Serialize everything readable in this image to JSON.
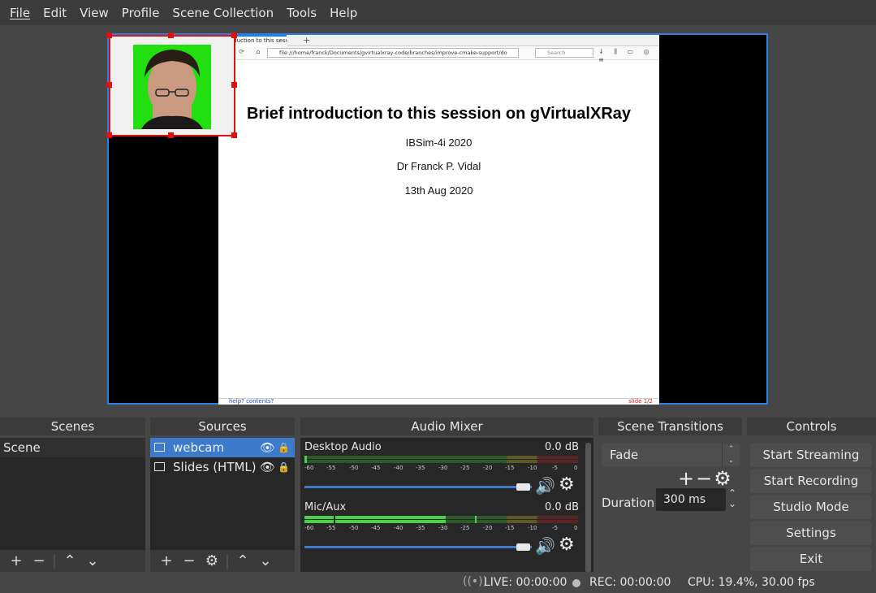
{
  "menu": [
    "File",
    "Edit",
    "View",
    "Profile",
    "Scene Collection",
    "Tools",
    "Help"
  ],
  "preview": {
    "browser": {
      "tab_title": "Introduction to this sess",
      "new_tab": "+",
      "url": "file:///home/franck/Documents/gvirtualxray-code/branches/improve-cmake-support/do",
      "search_placeholder": "Search",
      "slide_title": "Brief introduction to this session on gVirtualXRay",
      "event": "IBSim-4i 2020",
      "author": "Dr Franck P. Vidal",
      "date": "13th Aug 2020",
      "footer_left": "help? contents?",
      "footer_right": "slide 1/2"
    }
  },
  "scenes": {
    "title": "Scenes",
    "items": [
      "Scene"
    ]
  },
  "sources": {
    "title": "Sources",
    "items": [
      {
        "label": "webcam",
        "selected": true
      },
      {
        "label": "Slides (HTML)",
        "selected": false
      }
    ]
  },
  "mixer": {
    "title": "Audio Mixer",
    "channels": [
      {
        "name": "Desktop Audio",
        "db": "0.0 dB"
      },
      {
        "name": "Mic/Aux",
        "db": "0.0 dB"
      }
    ],
    "ticks": [
      "-60",
      "-55",
      "-50",
      "-45",
      "-40",
      "-35",
      "-30",
      "-25",
      "-20",
      "-15",
      "-10",
      "-5",
      "0"
    ]
  },
  "transitions": {
    "title": "Scene Transitions",
    "selected": "Fade",
    "duration_label": "Duration",
    "duration_value": "300 ms"
  },
  "controls": {
    "title": "Controls",
    "buttons": [
      "Start Streaming",
      "Start Recording",
      "Studio Mode",
      "Settings",
      "Exit"
    ]
  },
  "status": {
    "live": "LIVE: 00:00:00",
    "rec": "REC: 00:00:00",
    "cpu": "CPU: 19.4%, 30.00 fps"
  }
}
